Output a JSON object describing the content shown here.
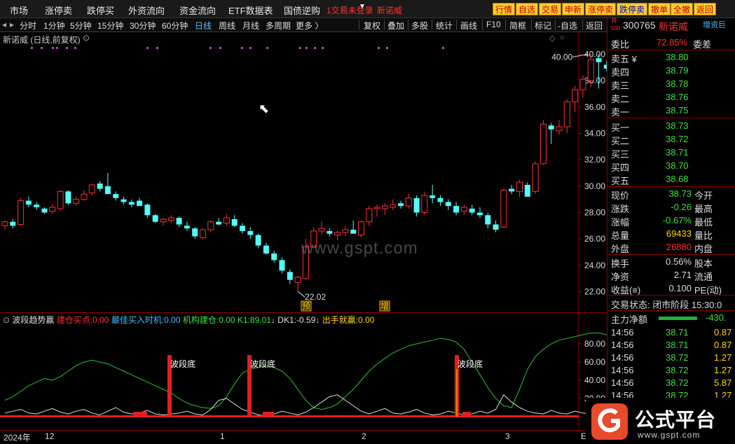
{
  "topmenu": {
    "items": [
      "市场",
      "涨停卖",
      "跌停买",
      "外资流向",
      "资金流向",
      "ETF数据表",
      "国债逆购"
    ],
    "trade_status": "1交易未登录",
    "stock_red": "新诺威",
    "buttons": [
      "行情",
      "自选",
      "交易",
      "申新",
      "涨停卖",
      "跌停卖",
      "撤单",
      "全撤",
      "返回"
    ]
  },
  "periodbar": {
    "periods": [
      "分时",
      "1分钟",
      "5分钟",
      "15分钟",
      "30分钟",
      "60分钟",
      "日线",
      "周线",
      "月线",
      "多周期",
      "更多 〉"
    ],
    "active": "日线",
    "tools": [
      "复权",
      "叠加",
      "多股",
      "统计",
      "画线",
      "F10",
      "简框",
      "标记",
      "-自选",
      "返回"
    ]
  },
  "main_chart": {
    "title": "新诺威 (日线,前复权)",
    "high_label": "40.00",
    "low_label": "22.02",
    "y_ticks": [
      "40.00",
      "38.00",
      "36.00",
      "34.00",
      "32.00",
      "30.00",
      "28.00",
      "26.00",
      "24.00",
      "22.00"
    ],
    "markers": [
      "预",
      "增"
    ],
    "watermark": "www.gspt.com"
  },
  "indicator": {
    "name": "波段趋势赢",
    "fields": [
      {
        "label": "建仓买点:",
        "value": "0.00",
        "color": "#ff3030"
      },
      {
        "label": "最佳买入时机:",
        "value": "0.00",
        "color": "#40c0ff"
      },
      {
        "label": "机构建仓:",
        "value": "0.00",
        "color": "#40e040"
      },
      {
        "label": "K1:",
        "value": "89.01",
        "color": "#40e040"
      },
      {
        "label": "DK1:",
        "value": "-0.59",
        "color": "#e0e0e0"
      },
      {
        "label": "出手就赢:",
        "value": "0.00",
        "color": "#ffd700"
      }
    ],
    "y_ticks": [
      "80.00",
      "60.00",
      "40.00",
      "20.00"
    ],
    "signal_label": "波段底"
  },
  "x_axis": {
    "labels": [
      "2024年",
      "12",
      "1",
      "2",
      "3"
    ],
    "end_label": "E"
  },
  "quote_panel": {
    "code": "300765",
    "name": "新诺威",
    "tag": "增资巨",
    "r_mark": "R",
    "r_sub": "500",
    "weibi_label": "委比",
    "weibi_value": "72.85%",
    "weicha_label": "委差",
    "asks": [
      {
        "label": "卖五 ¥",
        "price": "38.80"
      },
      {
        "label": "卖四",
        "price": "38.79"
      },
      {
        "label": "卖三",
        "price": "38.78"
      },
      {
        "label": "卖二",
        "price": "38.76"
      },
      {
        "label": "卖一",
        "price": "38.75"
      }
    ],
    "bids": [
      {
        "label": "买一",
        "price": "38.73"
      },
      {
        "label": "买二",
        "price": "38.72"
      },
      {
        "label": "买三",
        "price": "38.71"
      },
      {
        "label": "买四",
        "price": "38.70"
      },
      {
        "label": "买五",
        "price": "38.68"
      }
    ],
    "stats": [
      {
        "label": "现价",
        "value": "38.73",
        "right": "今开",
        "color": "#40e040"
      },
      {
        "label": "涨跌",
        "value": "-0.26",
        "right": "最高",
        "color": "#40e040"
      },
      {
        "label": "涨幅",
        "value": "-0.67%",
        "right": "最低",
        "color": "#40e040"
      },
      {
        "label": "总量",
        "value": "69433",
        "right": "量比",
        "color": "#ffd700"
      },
      {
        "label": "外盘",
        "value": "26880",
        "right": "内盘",
        "color": "#ff3030"
      }
    ],
    "stats2": [
      {
        "label": "换手",
        "value": "0.56%",
        "right": "股本"
      },
      {
        "label": "净资",
        "value": "2.71",
        "right": "流通"
      },
      {
        "label": "收益(≡)",
        "value": "0.100",
        "right": "PE(动)"
      }
    ],
    "trade_state": "交易状态: 闭市阶段 15:30:0",
    "main_flow_label": "主力净额",
    "main_flow_value": "-430.",
    "ticks": [
      {
        "time": "14:56",
        "price": "38.71",
        "vol": "0.87"
      },
      {
        "time": "14:56",
        "price": "38.71",
        "vol": "0.87"
      },
      {
        "time": "14:56",
        "price": "38.72",
        "vol": "1.27"
      },
      {
        "time": "14:56",
        "price": "38.72",
        "vol": "1.27"
      },
      {
        "time": "14:56",
        "price": "38.72",
        "vol": "5.87"
      },
      {
        "time": "14:56",
        "price": "38.72",
        "vol": "1.27"
      }
    ]
  },
  "logo": {
    "text": "公式平台",
    "url": "www.gspt.com"
  },
  "chart_data": {
    "type": "candlestick",
    "title": "新诺威 (日线,前复权)",
    "ylim": [
      21.5,
      40.5
    ],
    "candles": [
      [
        27.0,
        27.4,
        26.7,
        27.3
      ],
      [
        27.3,
        27.5,
        26.8,
        27.0
      ],
      [
        27.1,
        29.1,
        27.0,
        28.9
      ],
      [
        28.9,
        29.2,
        28.4,
        28.6
      ],
      [
        28.6,
        28.8,
        28.2,
        28.4
      ],
      [
        28.3,
        28.4,
        27.9,
        28.0
      ],
      [
        28.1,
        28.6,
        27.9,
        28.4
      ],
      [
        28.3,
        29.7,
        28.1,
        29.6
      ],
      [
        29.6,
        29.7,
        28.6,
        28.7
      ],
      [
        28.7,
        29.2,
        28.5,
        29.0
      ],
      [
        29.0,
        29.7,
        28.9,
        29.4
      ],
      [
        29.5,
        30.2,
        29.3,
        30.1
      ],
      [
        30.2,
        30.4,
        29.6,
        29.8
      ],
      [
        30.0,
        31.0,
        29.6,
        29.4
      ],
      [
        29.4,
        29.6,
        28.9,
        29.1
      ],
      [
        29.0,
        29.2,
        28.6,
        28.8
      ],
      [
        28.8,
        29.0,
        28.4,
        28.6
      ],
      [
        28.9,
        29.1,
        28.5,
        28.5
      ],
      [
        28.6,
        28.7,
        27.6,
        27.8
      ],
      [
        27.8,
        27.9,
        27.2,
        27.3
      ],
      [
        27.3,
        27.6,
        27.0,
        27.5
      ],
      [
        27.4,
        27.8,
        27.2,
        27.6
      ],
      [
        27.6,
        27.7,
        26.9,
        27.1
      ],
      [
        27.0,
        27.3,
        26.6,
        26.8
      ],
      [
        26.8,
        26.9,
        26.0,
        26.2
      ],
      [
        26.1,
        26.8,
        26.0,
        26.7
      ],
      [
        26.7,
        27.4,
        26.5,
        27.3
      ],
      [
        27.3,
        27.6,
        27.0,
        27.1
      ],
      [
        27.2,
        27.9,
        27.0,
        27.6
      ],
      [
        27.5,
        27.8,
        26.9,
        27.0
      ],
      [
        27.0,
        27.2,
        26.4,
        26.6
      ],
      [
        26.6,
        26.9,
        26.0,
        26.3
      ],
      [
        26.3,
        26.4,
        25.3,
        25.5
      ],
      [
        25.5,
        25.7,
        24.8,
        24.9
      ],
      [
        24.9,
        25.1,
        24.2,
        24.4
      ],
      [
        24.4,
        24.6,
        23.4,
        23.6
      ],
      [
        23.5,
        23.7,
        22.6,
        22.9
      ],
      [
        22.7,
        23.2,
        22.02,
        23.1
      ],
      [
        23.0,
        26.0,
        22.9,
        25.4
      ],
      [
        25.4,
        26.9,
        25.3,
        26.6
      ],
      [
        26.6,
        27.3,
        26.3,
        26.8
      ],
      [
        26.6,
        26.8,
        26.2,
        26.4
      ],
      [
        26.3,
        26.6,
        25.9,
        26.5
      ],
      [
        26.5,
        27.0,
        26.2,
        26.7
      ],
      [
        26.7,
        27.4,
        26.5,
        26.4
      ],
      [
        26.3,
        27.4,
        26.1,
        27.3
      ],
      [
        27.3,
        28.5,
        27.0,
        28.3
      ],
      [
        28.3,
        28.6,
        27.7,
        28.4
      ],
      [
        28.3,
        28.7,
        27.8,
        28.5
      ],
      [
        28.4,
        29.0,
        28.2,
        28.6
      ],
      [
        28.7,
        28.9,
        28.3,
        28.5
      ],
      [
        28.5,
        29.4,
        28.3,
        29.1
      ],
      [
        29.1,
        29.3,
        27.7,
        28.0
      ],
      [
        28.0,
        29.6,
        27.8,
        29.3
      ],
      [
        29.3,
        30.1,
        28.7,
        29.1
      ],
      [
        29.1,
        29.3,
        28.5,
        28.8
      ],
      [
        28.8,
        29.0,
        28.2,
        28.5
      ],
      [
        28.5,
        28.8,
        27.8,
        28.0
      ],
      [
        28.1,
        28.6,
        27.8,
        28.4
      ],
      [
        28.3,
        28.6,
        27.8,
        28.0
      ],
      [
        28.0,
        28.4,
        27.6,
        27.8
      ],
      [
        27.8,
        28.0,
        26.8,
        27.1
      ],
      [
        27.1,
        27.4,
        26.5,
        26.7
      ],
      [
        26.9,
        29.8,
        26.8,
        29.7
      ],
      [
        29.8,
        30.1,
        29.4,
        29.6
      ],
      [
        29.6,
        30.5,
        29.2,
        30.3
      ],
      [
        30.1,
        30.3,
        29.3,
        29.2
      ],
      [
        29.6,
        31.9,
        29.4,
        31.7
      ],
      [
        31.7,
        35.0,
        31.6,
        34.7
      ],
      [
        34.6,
        34.8,
        33.2,
        34.3
      ],
      [
        34.2,
        35.0,
        33.9,
        34.5
      ],
      [
        34.5,
        36.6,
        34.0,
        36.4
      ],
      [
        36.4,
        37.6,
        35.6,
        37.3
      ],
      [
        37.3,
        38.4,
        36.7,
        38.1
      ],
      [
        38.0,
        40.0,
        37.5,
        39.6
      ],
      [
        39.7,
        40.0,
        37.4,
        39.4
      ],
      [
        39.2,
        39.5,
        38.7,
        38.9
      ],
      [
        38.5,
        39.6,
        37.8,
        38.73
      ]
    ],
    "k1_series": "green line (K1)",
    "dk1_series": "white line (DK1)"
  }
}
